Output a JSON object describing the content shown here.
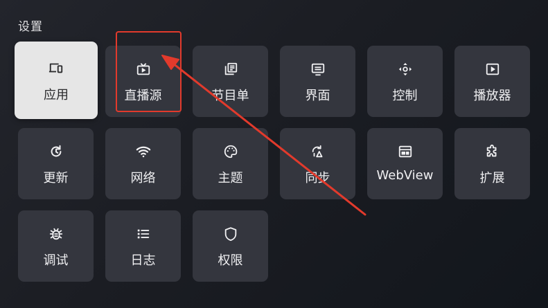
{
  "page": {
    "title": "设置"
  },
  "tiles": [
    {
      "label": "应用",
      "icon": "devices-icon",
      "focused": true
    },
    {
      "label": "直播源",
      "icon": "tv-play-icon",
      "focused": false
    },
    {
      "label": "节目单",
      "icon": "program-list-icon",
      "focused": false
    },
    {
      "label": "界面",
      "icon": "interface-icon",
      "focused": false
    },
    {
      "label": "控制",
      "icon": "dpad-icon",
      "focused": false
    },
    {
      "label": "播放器",
      "icon": "player-icon",
      "focused": false
    },
    {
      "label": "更新",
      "icon": "update-icon",
      "focused": false
    },
    {
      "label": "网络",
      "icon": "wifi-icon",
      "focused": false
    },
    {
      "label": "主题",
      "icon": "palette-icon",
      "focused": false
    },
    {
      "label": "同步",
      "icon": "sync-icon",
      "focused": false
    },
    {
      "label": "WebView",
      "icon": "webview-icon",
      "focused": false
    },
    {
      "label": "扩展",
      "icon": "extension-icon",
      "focused": false
    },
    {
      "label": "调试",
      "icon": "bug-icon",
      "focused": false
    },
    {
      "label": "日志",
      "icon": "log-list-icon",
      "focused": false
    },
    {
      "label": "权限",
      "icon": "shield-icon",
      "focused": false
    }
  ],
  "annotation": {
    "color": "#e23a2c",
    "highlighted_tile": "直播源"
  },
  "colors": {
    "tile_bg": "#34363e",
    "tile_focused_bg": "#e6e6e6",
    "text": "#f0f0f2"
  }
}
